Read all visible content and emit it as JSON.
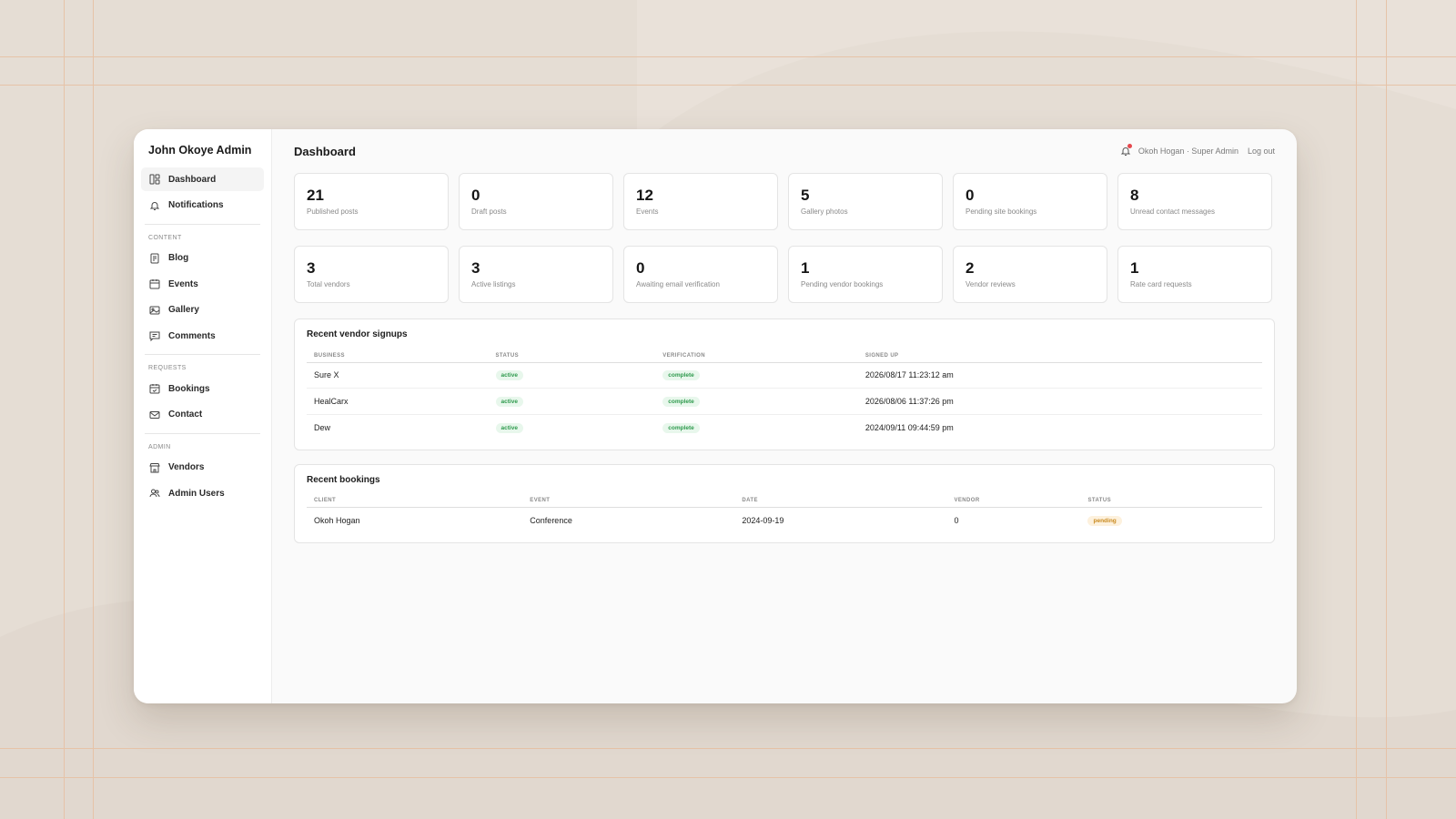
{
  "sidebar": {
    "brand": "John Okoye Admin",
    "top_items": [
      {
        "label": "Dashboard",
        "icon": "dashboard-icon",
        "active": true
      },
      {
        "label": "Notifications",
        "icon": "bell-icon",
        "active": false
      }
    ],
    "sections": [
      {
        "label": "CONTENT",
        "items": [
          {
            "label": "Blog",
            "icon": "document-icon"
          },
          {
            "label": "Events",
            "icon": "calendar-icon"
          },
          {
            "label": "Gallery",
            "icon": "image-icon"
          },
          {
            "label": "Comments",
            "icon": "comment-icon"
          }
        ]
      },
      {
        "label": "REQUESTS",
        "items": [
          {
            "label": "Bookings",
            "icon": "calendar-check-icon"
          },
          {
            "label": "Contact",
            "icon": "mail-icon"
          }
        ]
      },
      {
        "label": "ADMIN",
        "items": [
          {
            "label": "Vendors",
            "icon": "store-icon"
          },
          {
            "label": "Admin Users",
            "icon": "users-icon"
          }
        ]
      }
    ]
  },
  "header": {
    "title": "Dashboard",
    "user": "Okoh Hogan · Super Admin",
    "logout": "Log out"
  },
  "stats": [
    {
      "value": "21",
      "label": "Published posts"
    },
    {
      "value": "0",
      "label": "Draft posts"
    },
    {
      "value": "12",
      "label": "Events"
    },
    {
      "value": "5",
      "label": "Gallery photos"
    },
    {
      "value": "0",
      "label": "Pending site bookings"
    },
    {
      "value": "8",
      "label": "Unread contact messages"
    },
    {
      "value": "3",
      "label": "Total vendors"
    },
    {
      "value": "3",
      "label": "Active listings"
    },
    {
      "value": "0",
      "label": "Awaiting email verification"
    },
    {
      "value": "1",
      "label": "Pending vendor bookings"
    },
    {
      "value": "2",
      "label": "Vendor reviews"
    },
    {
      "value": "1",
      "label": "Rate card requests"
    }
  ],
  "vendor_signups": {
    "title": "Recent vendor signups",
    "columns": [
      "BUSINESS",
      "STATUS",
      "VERIFICATION",
      "SIGNED UP"
    ],
    "rows": [
      {
        "business": "Sure X",
        "status": "active",
        "verification": "complete",
        "signed_up": "2026/08/17 11:23:12 am"
      },
      {
        "business": "HealCarx",
        "status": "active",
        "verification": "complete",
        "signed_up": "2026/08/06 11:37:26 pm"
      },
      {
        "business": "Dew",
        "status": "active",
        "verification": "complete",
        "signed_up": "2024/09/11 09:44:59 pm"
      }
    ]
  },
  "bookings": {
    "title": "Recent bookings",
    "columns": [
      "CLIENT",
      "EVENT",
      "DATE",
      "VENDOR",
      "STATUS"
    ],
    "rows": [
      {
        "client": "Okoh Hogan",
        "event": "Conference",
        "date": "2024-09-19",
        "vendor": "0",
        "status": "pending"
      }
    ]
  },
  "colors": {
    "background": "#e5ddd4",
    "badge_green": "#2e9a4d",
    "badge_amber": "#c98a1f",
    "notification_dot": "#e5484d"
  }
}
